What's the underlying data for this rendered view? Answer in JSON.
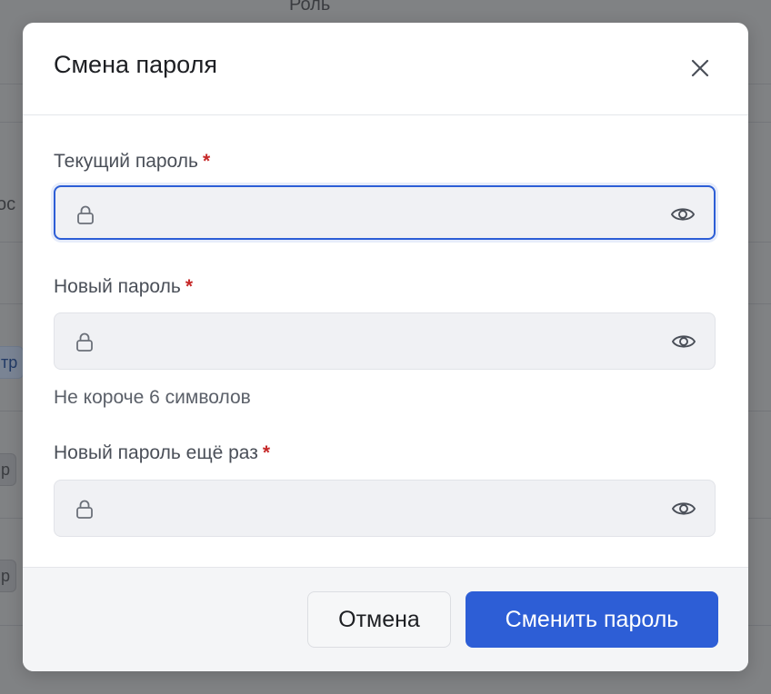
{
  "background": {
    "header_text": "Роль",
    "fragments": [
      "ос",
      "тр",
      "р",
      "р"
    ]
  },
  "modal": {
    "title": "Смена пароля",
    "close_icon": "close-icon",
    "required_mark": "*",
    "fields": [
      {
        "label": "Текущий пароль",
        "value": "",
        "focused": true
      },
      {
        "label": "Новый пароль",
        "value": "",
        "hint": "Не короче 6 символов"
      },
      {
        "label": "Новый пароль ещё раз",
        "value": ""
      }
    ],
    "field_icons": {
      "leading": "lock-icon",
      "trailing": "eye-icon"
    }
  },
  "footer": {
    "cancel_label": "Отмена",
    "submit_label": "Сменить пароль"
  },
  "colors": {
    "accent": "#2d5ed6",
    "required": "#c62828",
    "overlay": "#808284"
  }
}
